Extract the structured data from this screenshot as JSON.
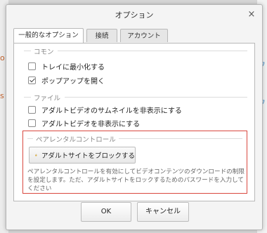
{
  "dialog": {
    "title": "オプション",
    "close_symbol": "×"
  },
  "tabs": [
    {
      "label": "一般的なオプション",
      "active": true
    },
    {
      "label": "接続",
      "active": false
    },
    {
      "label": "アカウント",
      "active": false
    }
  ],
  "sections": {
    "common": {
      "label": "コモン",
      "options": [
        {
          "label": "トレイに最小化する",
          "checked": false
        },
        {
          "label": "ポップアップを開く",
          "checked": true
        }
      ]
    },
    "file": {
      "label": "ファイル",
      "options": [
        {
          "label": "アダルトビデオのサムネイルを非表示にする",
          "checked": false
        },
        {
          "label": "アダルトビデオを非表示にする",
          "checked": false
        }
      ]
    },
    "parental": {
      "label": "ペアレンタルコントロール",
      "button_label": "アダルトサイトをブロックする",
      "description": "ペアレンタルコントロールを有効にしてビデオコンテンツのダウンロードの制限を設定します。ただ、アダルトサイトをロックするためのパスワードを入力してください"
    }
  },
  "footer": {
    "ok_label": "OK",
    "cancel_label": "キャンセル"
  },
  "colors": {
    "highlight_border": "#d9473f",
    "background": "#f4f4f4"
  }
}
